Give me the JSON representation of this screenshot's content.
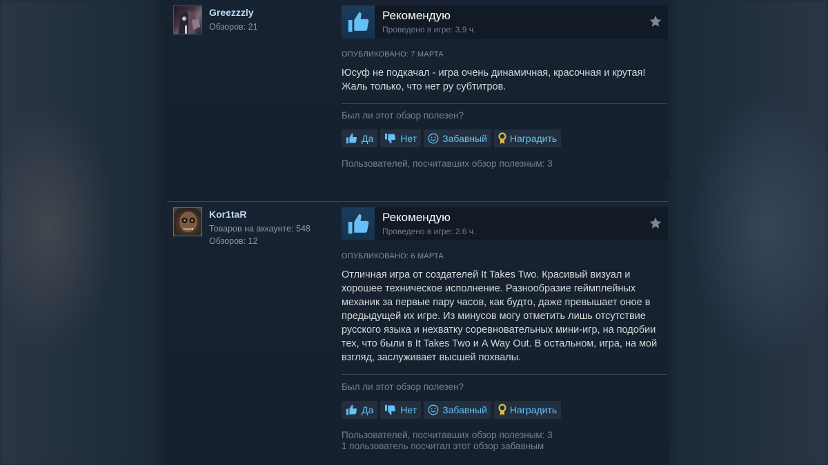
{
  "reviews": [
    {
      "author": "Greezzzly",
      "meta": [
        "Обзоров: 21"
      ],
      "recommendation": "Рекомендую",
      "hours": "Проведено в игре: 3.9 ч.",
      "posted": "ОПУБЛИКОВАНО: 7 МАРТА",
      "content": "Юсуф не подкачал - игра очень динамичная, красочная и крутая! Жаль только, что нет ру субтитров.",
      "helpful_question": "Был ли этот обзор полезен?",
      "buttons": {
        "yes": "Да",
        "no": "Нет",
        "funny": "Забавный",
        "award": "Наградить"
      },
      "counts": [
        "Пользователей, посчитавших обзор полезным: 3"
      ]
    },
    {
      "author": "Kor1taR",
      "meta": [
        "Товаров на аккаунте: 548",
        "Обзоров: 12"
      ],
      "recommendation": "Рекомендую",
      "hours": "Проведено в игре: 2.6 ч.",
      "posted": "ОПУБЛИКОВАНО: 6 МАРТА",
      "content": "Отличная игра от создателей It Takes Two. Красивый визуал и хорошее техническое исполнение. Разнообразие геймплейных механик за первые пару часов, как будто, даже превышает оное в предыдущей их игре. Из минусов могу отметить лишь отсутствие русского языка и нехватку соревновательных мини-игр, на подобии тех, что были в It Takes Two и A Way Out. В остальном, игра, на мой взгляд, заслуживает высшей похвалы.",
      "helpful_question": "Был ли этот обзор полезен?",
      "buttons": {
        "yes": "Да",
        "no": "Нет",
        "funny": "Забавный",
        "award": "Наградить"
      },
      "counts": [
        "Пользователей, посчитавших обзор полезным: 3",
        "1 пользователь посчитал этот обзор забавным"
      ]
    }
  ],
  "colors": {
    "accent_link": "#66c0f4",
    "author_name": "#c1dbf4",
    "thumb_up": "#66c0f4",
    "award_icon": "#e8b83a"
  },
  "icons": [
    "thumbs-up-icon",
    "thumbs-down-icon",
    "smile-icon",
    "award-icon",
    "star-icon"
  ]
}
